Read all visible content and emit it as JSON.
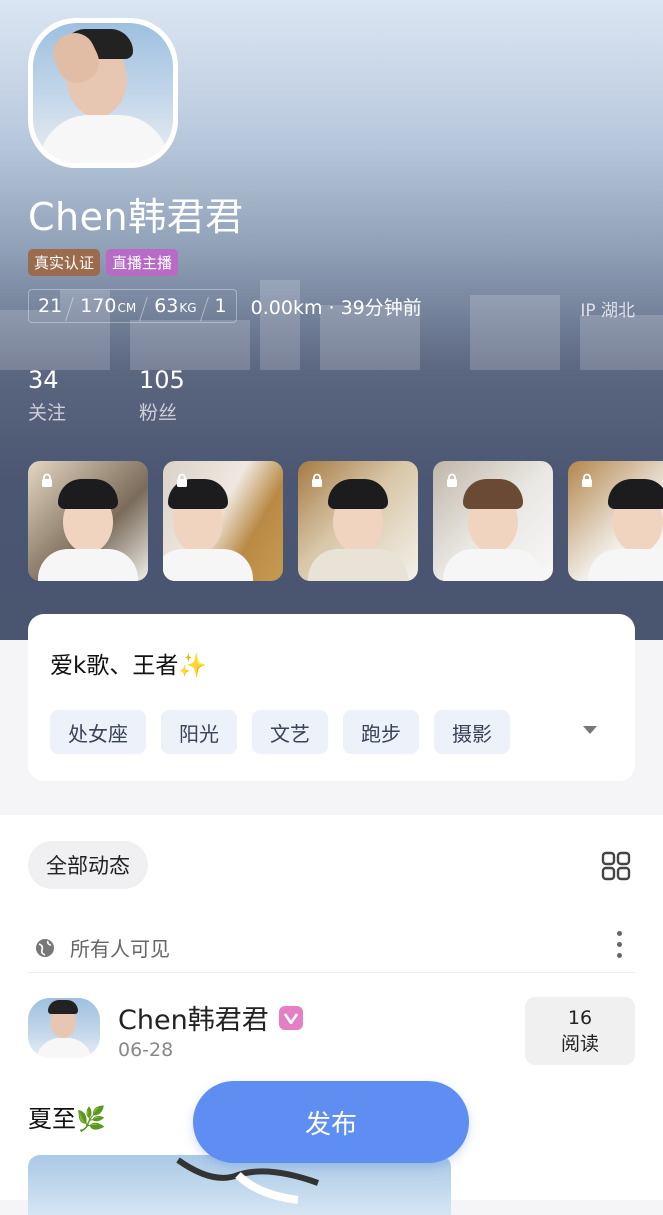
{
  "profile": {
    "name": "Chen韩君君",
    "badges": [
      "真实认证",
      "直播主播"
    ],
    "age": "21",
    "height": "170",
    "height_unit": "CM",
    "weight": "63",
    "weight_unit": "KG",
    "extra": "1",
    "distance_time": "0.00km · 39分钟前",
    "ip": "IP 湖北"
  },
  "follow": {
    "following_count": "34",
    "following_label": "关注",
    "fans_count": "105",
    "fans_label": "粉丝"
  },
  "bio": {
    "text": "爱k歌、王者✨",
    "tags": [
      "处女座",
      "阳光",
      "文艺",
      "跑步",
      "摄影"
    ]
  },
  "feed": {
    "filter_label": "全部动态",
    "visibility": "所有人可见",
    "post": {
      "author": "Chen韩君君",
      "date": "06-28",
      "read_count": "16",
      "read_label": "阅读",
      "text": "夏至🌿"
    }
  },
  "publish_label": "发布",
  "colors": {
    "accent": "#5e8ef2",
    "verify_badge": "#9a6b4d",
    "live_badge": "#b86bc5",
    "vip_badge": "#e57fc4"
  }
}
